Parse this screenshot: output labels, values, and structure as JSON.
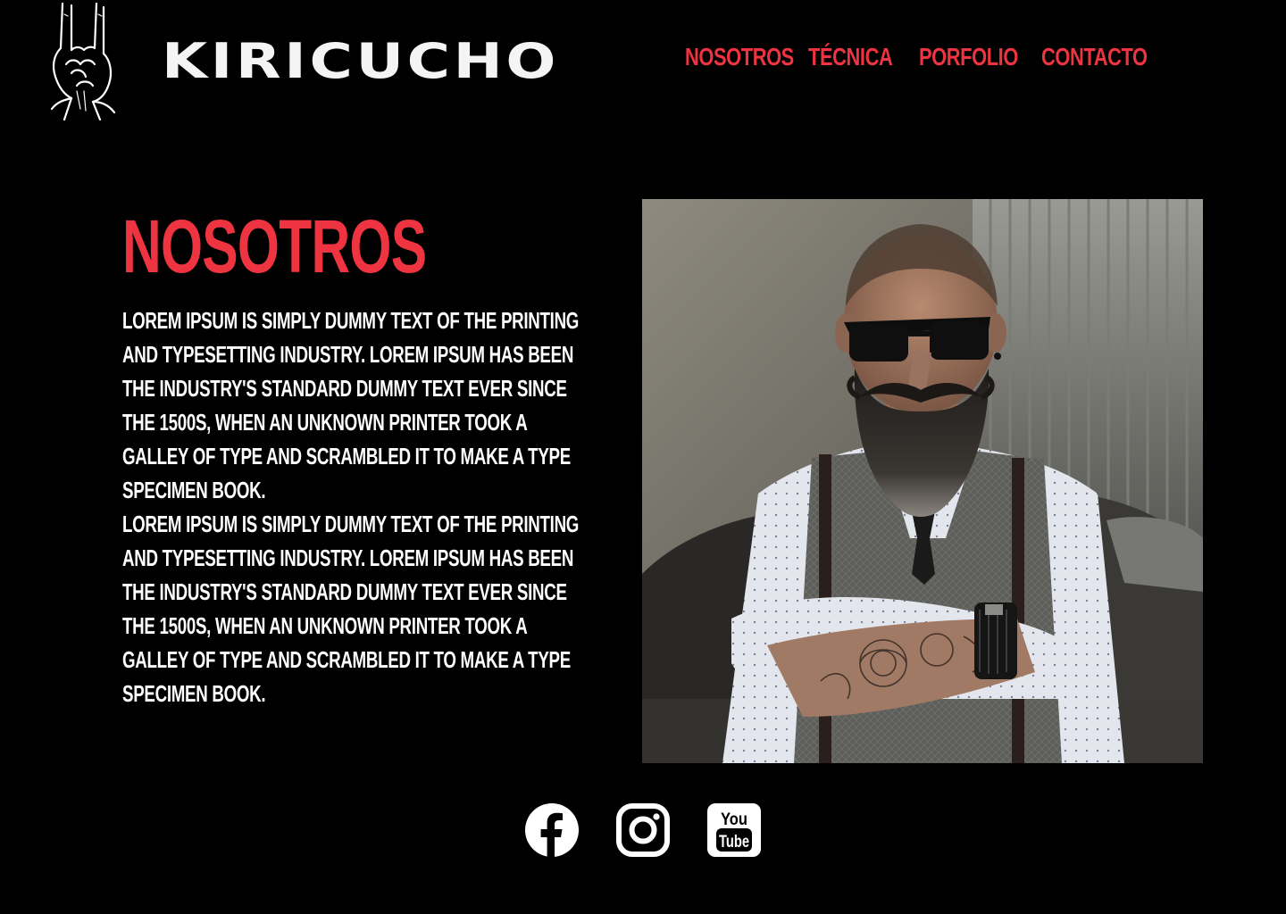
{
  "brand": {
    "name": "KIRICUCHO",
    "logo_icon": "rock-hand-icon"
  },
  "nav": {
    "items": [
      {
        "label": "NOSOTROS"
      },
      {
        "label": "TÉCNICA"
      },
      {
        "label": "PORFOLIO"
      },
      {
        "label": "CONTACTO"
      }
    ]
  },
  "main": {
    "title": "NOSOTROS",
    "paragraphs": [
      "Lorem Ipsum is simply dummy text of the printing and typesetting industry. Lorem Ipsum has been the industry's standard dummy text ever since the 1500s, when an unknown printer took a galley of type and scrambled it to make a type specimen book.",
      "Lorem Ipsum is simply dummy text of the printing and typesetting industry. Lorem Ipsum has been the industry's standard dummy text ever since the 1500s, when an unknown printer took a galley of type and scrambled it to make a type specimen book."
    ],
    "photo_subject": "bearded-man-portrait"
  },
  "socials": [
    {
      "name": "facebook-icon"
    },
    {
      "name": "instagram-icon"
    },
    {
      "name": "youtube-icon",
      "label_top": "You",
      "label_bottom": "Tube"
    }
  ],
  "colors": {
    "background": "#000000",
    "accent": "#ee3440",
    "text": "#ffffff"
  }
}
